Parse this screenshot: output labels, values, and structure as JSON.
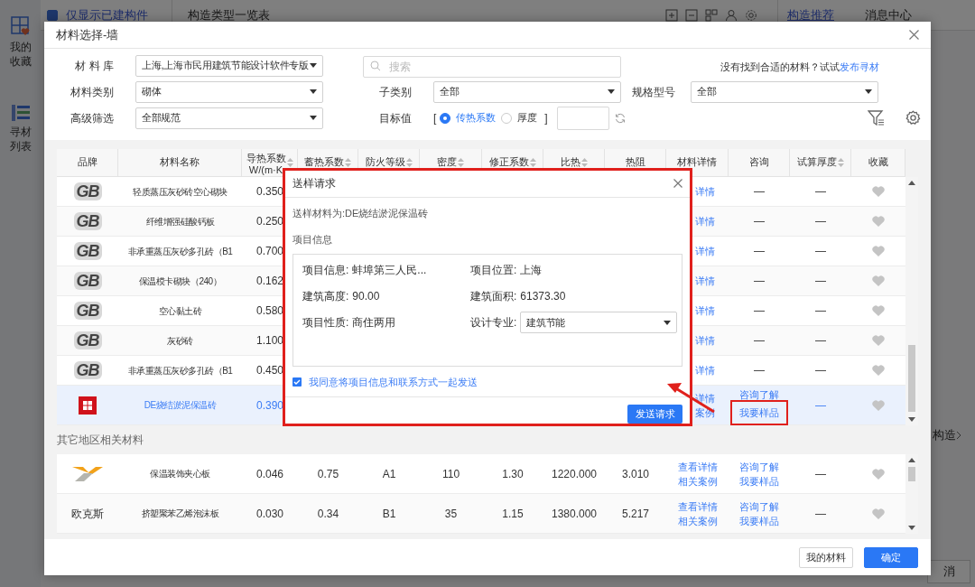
{
  "background": {
    "sidebar": [
      {
        "label": "我的收藏",
        "kind": "favorites"
      },
      {
        "label": "寻材列表",
        "kind": "list"
      }
    ],
    "built_only": {
      "label": "仅显示已建构件",
      "checked": true
    },
    "title": "构造类型一览表",
    "tabs": [
      {
        "label": "构造推荐",
        "selected": true
      },
      {
        "label": "消息中心",
        "selected": false
      }
    ],
    "side_link": "构造",
    "cancel_button": "消"
  },
  "dialog": {
    "title": "材料选择-墙",
    "library": {
      "label": "材 料 库",
      "value": "上海,上海市民用建筑节能设计软件专版"
    },
    "search": {
      "placeholder": "搜索"
    },
    "hint": {
      "text": "没有找到合适的材料？试试",
      "link": "发布寻材"
    },
    "category": {
      "label": "材料类别",
      "value": "砌体"
    },
    "subcategory": {
      "label": "子类别",
      "value": "全部"
    },
    "spec": {
      "label": "规格型号",
      "value": "全部"
    },
    "advanced": {
      "label": "高级筛选",
      "value": "全部规范"
    },
    "target": {
      "label": "目标值",
      "open_bracket": "[",
      "options": [
        {
          "label": "传热系数",
          "selected": true
        },
        {
          "label": "厚度",
          "selected": false
        }
      ],
      "close_bracket": "]"
    },
    "columns": [
      {
        "label": "品牌",
        "sortable": false
      },
      {
        "label": "材料名称",
        "sortable": false
      },
      {
        "label": "导热系数",
        "unit": "W/(m·K",
        "sortable": true
      },
      {
        "label": "蓄热系数",
        "sortable": true
      },
      {
        "label": "防火等级",
        "sortable": true
      },
      {
        "label": "密度",
        "sortable": true
      },
      {
        "label": "修正系数",
        "sortable": true
      },
      {
        "label": "比热",
        "sortable": true
      },
      {
        "label": "热阻",
        "sortable": false
      },
      {
        "label": "材料详情",
        "sortable": false
      },
      {
        "label": "咨询",
        "sortable": false
      },
      {
        "label": "试算厚度",
        "sortable": true
      },
      {
        "label": "收藏",
        "sortable": false
      }
    ],
    "rows": [
      {
        "brand": {
          "kind": "text_logo",
          "text": "GB"
        },
        "name": "轻质蒸压灰砂砖空心砌块",
        "values": [
          "0.350"
        ],
        "details": [
          "详情"
        ],
        "consult": [
          {
            "kind": "dash",
            "text": "—"
          }
        ],
        "thickness": {
          "kind": "dash",
          "text": "—"
        },
        "selected": false
      },
      {
        "brand": {
          "kind": "text_logo",
          "text": "GB"
        },
        "name": "纤维增强硅酸钙板",
        "values": [
          "0.250"
        ],
        "details": [
          "详情"
        ],
        "consult": [
          {
            "kind": "dash",
            "text": "—"
          }
        ],
        "thickness": {
          "kind": "dash",
          "text": "—"
        },
        "selected": false
      },
      {
        "brand": {
          "kind": "text_logo",
          "text": "GB"
        },
        "name": "非承重蒸压灰砂多孔砖（B1",
        "values": [
          "0.700"
        ],
        "details": [
          "详情"
        ],
        "consult": [
          {
            "kind": "dash",
            "text": "—"
          }
        ],
        "thickness": {
          "kind": "dash",
          "text": "—"
        },
        "selected": false
      },
      {
        "brand": {
          "kind": "text_logo",
          "text": "GB"
        },
        "name": "保温模卡砌块（240）",
        "values": [
          "0.162"
        ],
        "details": [
          "详情"
        ],
        "consult": [
          {
            "kind": "dash",
            "text": "—"
          }
        ],
        "thickness": {
          "kind": "dash",
          "text": "—"
        },
        "selected": false
      },
      {
        "brand": {
          "kind": "text_logo",
          "text": "GB"
        },
        "name": "空心黏土砖",
        "values": [
          "0.580"
        ],
        "details": [
          "详情"
        ],
        "consult": [
          {
            "kind": "dash",
            "text": "—"
          }
        ],
        "thickness": {
          "kind": "dash",
          "text": "—"
        },
        "selected": false
      },
      {
        "brand": {
          "kind": "text_logo",
          "text": "GB"
        },
        "name": "灰砂砖",
        "values": [
          "1.100"
        ],
        "details": [
          "详情"
        ],
        "consult": [
          {
            "kind": "dash",
            "text": "—"
          }
        ],
        "thickness": {
          "kind": "dash",
          "text": "—"
        },
        "selected": false
      },
      {
        "brand": {
          "kind": "text_logo",
          "text": "GB"
        },
        "name": "非承重蒸压灰砂多孔砖（B1",
        "values": [
          "0.450"
        ],
        "details": [
          "详情"
        ],
        "consult": [
          {
            "kind": "dash",
            "text": "—"
          }
        ],
        "thickness": {
          "kind": "dash",
          "text": "—"
        },
        "selected": false
      },
      {
        "brand": {
          "kind": "icon"
        },
        "name": "DE烧结淤泥保温砖",
        "values": [
          "0.390"
        ],
        "details": [
          "详情",
          "案例"
        ],
        "consult": [
          {
            "kind": "link",
            "text": "咨询了解",
            "highlighted": false
          },
          {
            "kind": "link",
            "text": "我要样品",
            "highlighted": true
          }
        ],
        "thickness": {
          "kind": "link",
          "text": "—"
        },
        "selected": true
      }
    ],
    "other_section": "其它地区相关材料",
    "other_rows": [
      {
        "brand": {
          "kind": "picture_logo"
        },
        "name": "保温装饰夹心板",
        "values": [
          "0.046",
          "0.75",
          "A1",
          "110",
          "1.30",
          "1220.000",
          "3.010"
        ],
        "details": [
          "查看详情",
          "相关案例"
        ],
        "consult": [
          {
            "kind": "link",
            "text": "咨询了解",
            "highlighted": false
          },
          {
            "kind": "link",
            "text": "我要样品",
            "highlighted": false
          }
        ],
        "thickness": {
          "kind": "dash",
          "text": "—"
        },
        "selected": false
      },
      {
        "brand": {
          "kind": "text",
          "text": "欧克斯"
        },
        "name": "挤塑聚苯乙烯泡沫板",
        "values": [
          "0.030",
          "0.34",
          "B1",
          "35",
          "1.15",
          "1380.000",
          "5.217"
        ],
        "details": [
          "查看详情",
          "相关案例"
        ],
        "consult": [
          {
            "kind": "link",
            "text": "咨询了解",
            "highlighted": false
          },
          {
            "kind": "link",
            "text": "我要样品",
            "highlighted": false
          }
        ],
        "thickness": {
          "kind": "dash",
          "text": "—"
        },
        "selected": false
      }
    ],
    "buttons": [
      {
        "label": "我的材料",
        "kind": "secondary"
      },
      {
        "label": "确定",
        "kind": "primary"
      }
    ]
  },
  "popup": {
    "title": "送样请求",
    "outlined": true,
    "material": "送样材料为:DE烧结淤泥保温砖",
    "section": "项目信息",
    "fields": [
      {
        "kind": "text",
        "label": "项目信息:",
        "value": "蚌埠第三人民..."
      },
      {
        "kind": "text",
        "label": "项目位置:",
        "value": "上海"
      },
      {
        "kind": "text",
        "label": "建筑高度:",
        "value": "90.00"
      },
      {
        "kind": "text",
        "label": "建筑面积:",
        "value": "61373.30"
      },
      {
        "kind": "text",
        "label": "项目性质:",
        "value": "商住两用"
      },
      {
        "kind": "select",
        "label": "设计专业:",
        "value": "建筑节能"
      }
    ],
    "consent": {
      "label": "我同意将项目信息和联系方式一起发送",
      "checked": true
    },
    "submit": "发送请求"
  },
  "annotation_arrow": true
}
